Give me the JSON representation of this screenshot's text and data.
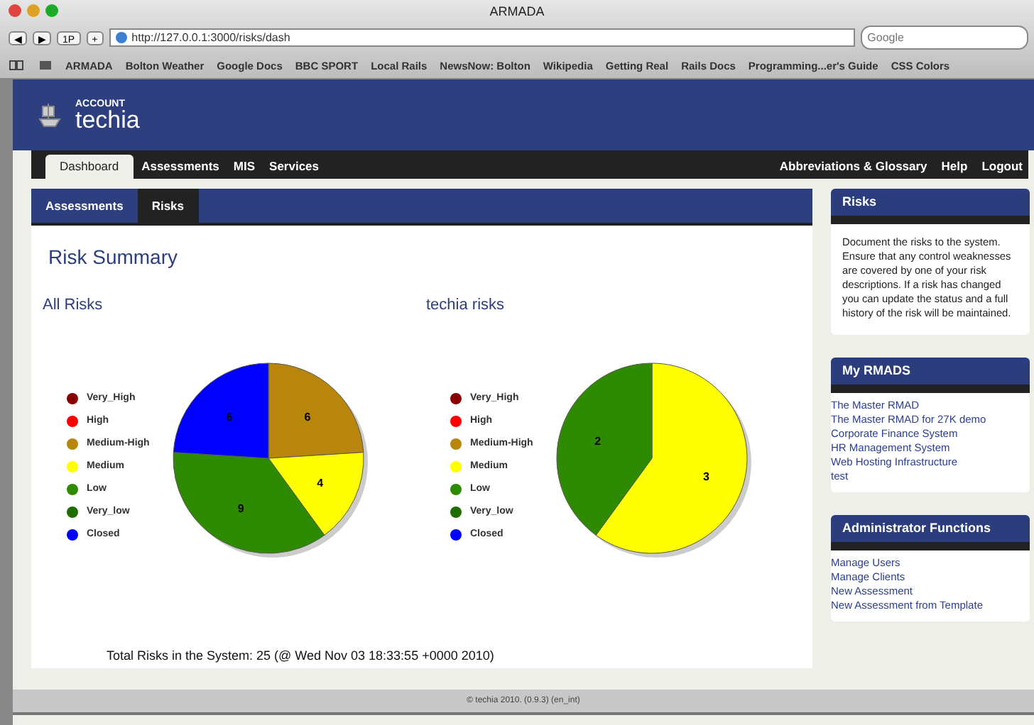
{
  "window": {
    "title": "ARMADA"
  },
  "toolbar": {
    "url": "http://127.0.0.1:3000/risks/dash",
    "search_placeholder": "Google",
    "buttons": [
      "◀",
      "▶",
      "1P",
      "+"
    ]
  },
  "bookmarks": [
    "ARMADA",
    "Bolton Weather",
    "Google Docs",
    "BBC SPORT",
    "Local Rails",
    "NewsNow: Bolton",
    "Wikipedia",
    "Getting Real",
    "Rails Docs",
    "Programming...er's Guide",
    "CSS Colors"
  ],
  "header": {
    "account_label": "ACCOUNT",
    "account_name": "techia"
  },
  "nav": {
    "left": [
      {
        "label": "Dashboard",
        "selected": true
      },
      {
        "label": "Assessments",
        "selected": false
      },
      {
        "label": "MIS",
        "selected": false
      },
      {
        "label": "Services",
        "selected": false
      }
    ],
    "right": [
      "Abbreviations & Glossary",
      "Help",
      "Logout"
    ]
  },
  "subtabs": [
    {
      "label": "Assessments",
      "selected": false
    },
    {
      "label": "Risks",
      "selected": true
    }
  ],
  "heading": "Risk Summary",
  "charts": [
    {
      "legend": [
        {
          "color": "#8b0000"
        },
        {
          "color": "#ff0000"
        },
        {
          "color": "#b8860b"
        },
        {
          "color": "#ffff00"
        },
        {
          "color": "#2e8b00"
        },
        {
          "color": "#1e6e00"
        },
        {
          "color": "#0000ff"
        }
      ],
      "chart_data": {
        "type": "pie",
        "title": "All Risks",
        "categories": [
          "Very_High",
          "High",
          "Medium-High",
          "Medium",
          "Low",
          "Very_low",
          "Closed"
        ],
        "values": [
          0,
          0,
          6,
          4,
          9,
          0,
          6
        ],
        "data_labels": true
      }
    },
    {
      "legend": [
        {
          "color": "#8b0000"
        },
        {
          "color": "#ff0000"
        },
        {
          "color": "#b8860b"
        },
        {
          "color": "#ffff00"
        },
        {
          "color": "#2e8b00"
        },
        {
          "color": "#1e6e00"
        },
        {
          "color": "#0000ff"
        }
      ],
      "chart_data": {
        "type": "pie",
        "title": "techia risks",
        "categories": [
          "Very_High",
          "High",
          "Medium-High",
          "Medium",
          "Low",
          "Very_low",
          "Closed"
        ],
        "values": [
          0,
          0,
          0,
          3,
          2,
          0,
          0
        ],
        "data_labels": true
      }
    }
  ],
  "total": "Total Risks in the System: 25 (@ Wed Nov 03 18:33:55 +0000 2010)",
  "sidebar": [
    {
      "title": "Risks",
      "kind": "text",
      "text": "Document the risks to the system. Ensure that any control weaknesses are covered by one of your risk descriptions. If a risk has changed you can update the status and a full history of the risk will be maintained."
    },
    {
      "title": "My RMADS",
      "kind": "links",
      "links": [
        "The Master RMAD",
        "The Master RMAD for 27K demo",
        "Corporate Finance System",
        "HR Management System",
        "Web Hosting Infrastructure",
        "test"
      ]
    },
    {
      "title": "Administrator Functions",
      "kind": "links",
      "links": [
        "Manage Users",
        "Manage Clients",
        "New Assessment",
        "New Assessment from Template"
      ]
    }
  ],
  "footer": "© techia 2010. (0.9.3) (en_int)"
}
